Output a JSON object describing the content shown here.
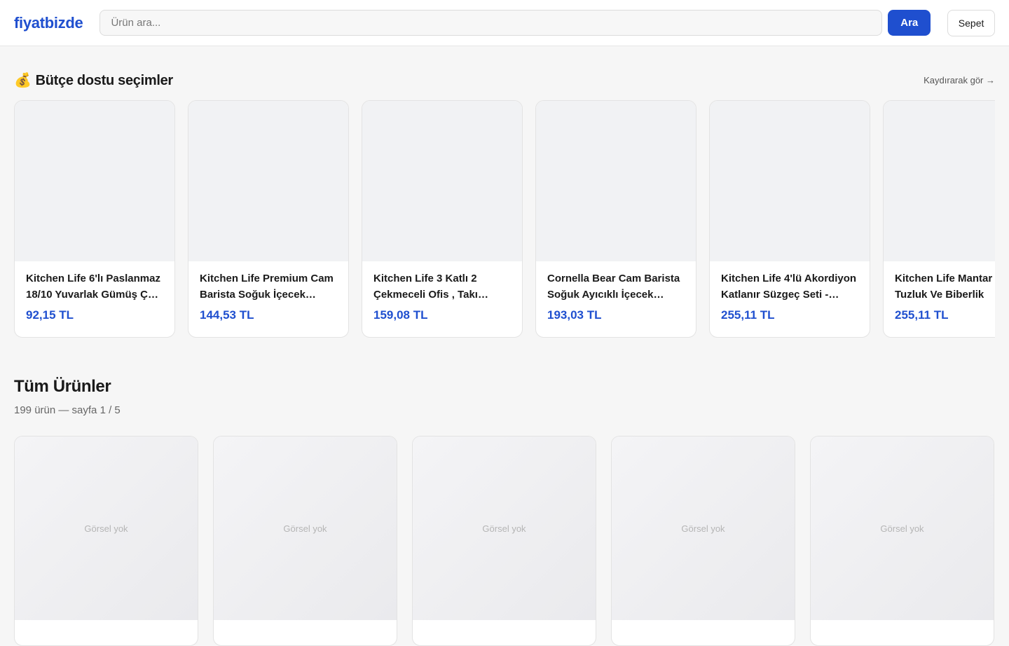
{
  "header": {
    "logo": "fiyatbizde",
    "search_placeholder": "Ürün ara...",
    "search_button": "Ara",
    "cart_button": "Sepet"
  },
  "budget": {
    "icon": "💰",
    "title": "Bütçe dostu seçimler",
    "scroll_hint": "Kaydırarak gör →",
    "items": [
      {
        "name": "Kitchen Life 6'lı Paslanmaz 18/10 Yuvarlak Gümüş Çay Kaşığı",
        "price": "92,15 TL"
      },
      {
        "name": "Kitchen Life Premium Cam Barista Soğuk İçecek Bardağı",
        "price": "144,53 TL"
      },
      {
        "name": "Kitchen Life 3 Katlı 2 Çekmeceli Ofis , Takı Düzenleyici",
        "price": "159,08 TL"
      },
      {
        "name": "Cornella Bear Cam Barista Soğuk Ayıcıklı İçecek Bardağı",
        "price": "193,03 TL"
      },
      {
        "name": "Kitchen Life 4'lü Akordiyon Katlanır Süzgeç Seti - Mutfak",
        "price": "255,11 TL"
      },
      {
        "name": "Kitchen Life Mantar Bambu Tuzluk Ve Biberlik",
        "price": "255,11 TL"
      }
    ]
  },
  "all_products": {
    "title": "Tüm Ürünler",
    "meta": "199 ürün — sayfa 1 / 5",
    "items": [
      {
        "image_label": "Görsel yok"
      },
      {
        "image_label": "Görsel yok"
      },
      {
        "image_label": "Görsel yok"
      },
      {
        "image_label": "Görsel yok"
      },
      {
        "image_label": "Görsel yok"
      }
    ]
  }
}
